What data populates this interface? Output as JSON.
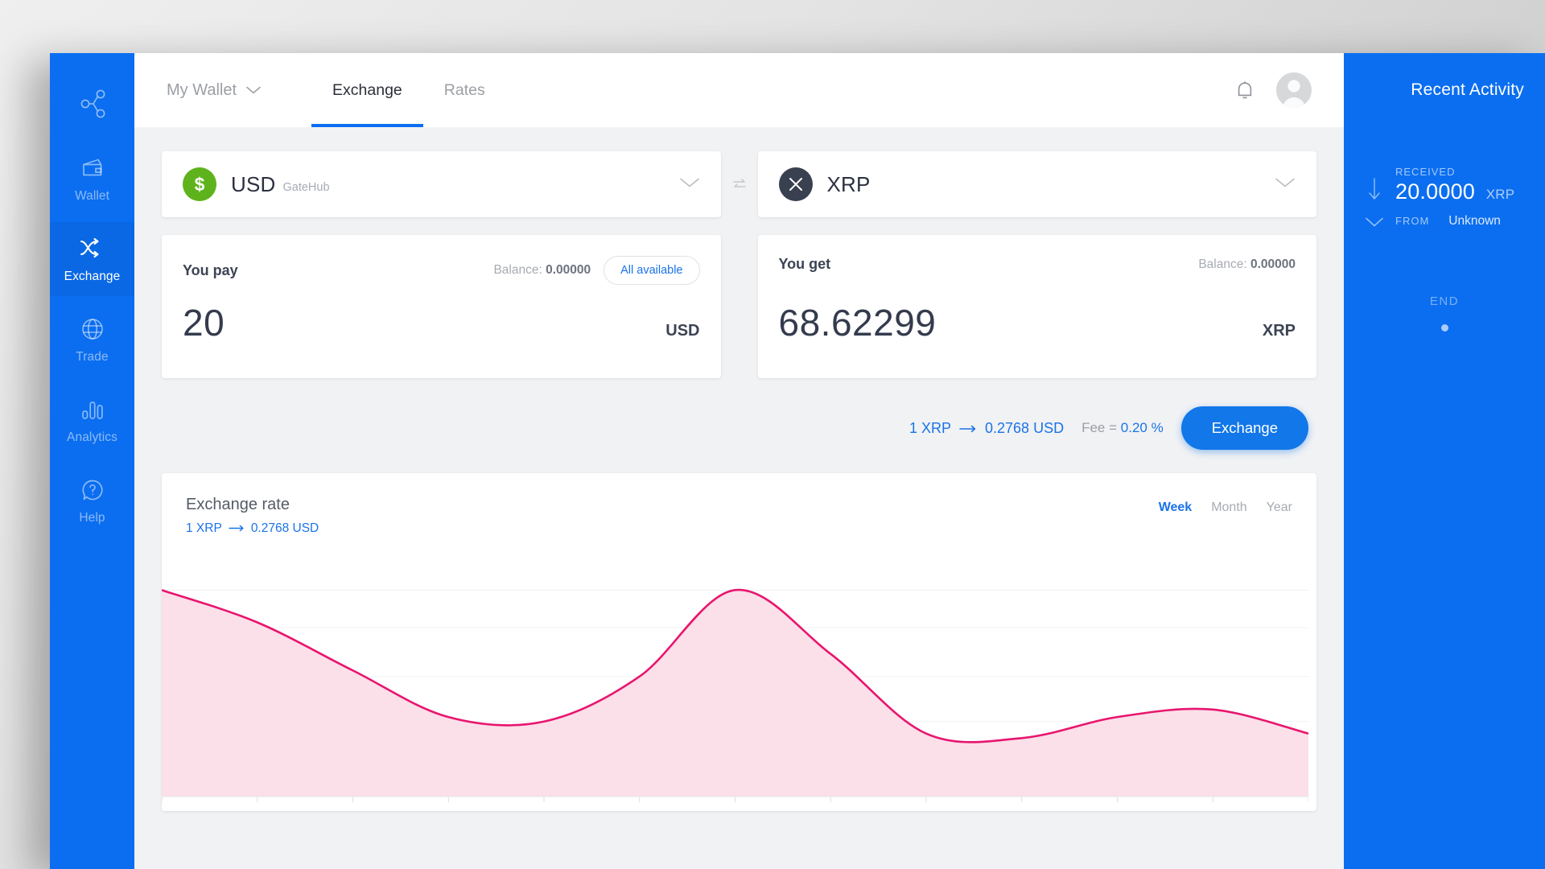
{
  "sidebar": {
    "logo_icon": "share-nodes-icon",
    "items": [
      {
        "label": "Wallet",
        "icon": "wallet-icon",
        "active": false
      },
      {
        "label": "Exchange",
        "icon": "shuffle-icon",
        "active": true
      },
      {
        "label": "Trade",
        "icon": "globe-icon",
        "active": false
      },
      {
        "label": "Analytics",
        "icon": "bar-chart-icon",
        "active": false
      },
      {
        "label": "Help",
        "icon": "question-help-icon",
        "active": false
      }
    ]
  },
  "topbar": {
    "wallet_selector": "My Wallet",
    "wallet_chevron_icon": "chevron-down-icon",
    "tabs": [
      {
        "label": "Exchange",
        "active": true
      },
      {
        "label": "Rates",
        "active": false
      }
    ],
    "notifications_icon": "bell-icon",
    "avatar_icon": "user-avatar-icon"
  },
  "exchange": {
    "from": {
      "code": "USD",
      "issuer": "GateHub",
      "badge_symbol": "$",
      "badge_color": "#5eb31c",
      "chevron_icon": "chevron-down-icon"
    },
    "swap_icon": "swap-horizontal-icon",
    "to": {
      "code": "XRP",
      "issuer": "",
      "badge_symbol": "✕",
      "badge_color": "#39404f",
      "chevron_icon": "chevron-down-icon"
    },
    "pay": {
      "title": "You pay",
      "balance_label": "Balance:",
      "balance_value": "0.00000",
      "all_available_label": "All available",
      "amount": "20",
      "currency": "USD",
      "placeholder": "0"
    },
    "get": {
      "title": "You get",
      "balance_label": "Balance:",
      "balance_value": "0.00000",
      "amount": "68.62299",
      "currency": "XRP",
      "placeholder": "0"
    },
    "rate_from": "1 XRP",
    "rate_arrow_icon": "arrow-right-icon",
    "rate_to": "0.2768 USD",
    "fee_label": "Fee =",
    "fee_value": "0.20 %",
    "exchange_button": "Exchange"
  },
  "chart_panel": {
    "title": "Exchange rate",
    "rate_from": "1 XRP",
    "rate_arrow_icon": "arrow-right-icon",
    "rate_to": "0.2768 USD",
    "ranges": [
      {
        "label": "Week",
        "active": true
      },
      {
        "label": "Month",
        "active": false
      },
      {
        "label": "Year",
        "active": false
      }
    ]
  },
  "chart_data": {
    "type": "area",
    "title": "Exchange rate",
    "xlabel": "",
    "ylabel": "",
    "grid": true,
    "legend": null,
    "line_color": "#e8156e",
    "fill_color": "#fbdfe9",
    "ylim": [
      0.26,
      0.29
    ],
    "gridlines": [
      0.2875,
      0.2825,
      0.276,
      0.27
    ],
    "x": [
      0,
      1,
      2,
      3,
      4,
      5,
      6,
      7,
      8,
      9,
      10,
      11,
      12
    ],
    "values": [
      0.2875,
      0.2832,
      0.2768,
      0.2706,
      0.27,
      0.276,
      0.2875,
      0.279,
      0.2684,
      0.2678,
      0.2706,
      0.2716,
      0.2684
    ],
    "tick_count": 13
  },
  "activity": {
    "title": "Recent Activity",
    "items": [
      {
        "kind": "RECEIVED",
        "amount": "20.0000",
        "currency": "XRP",
        "from_label": "FROM",
        "from_value": "Unknown",
        "down_arrow_icon": "arrow-down-icon",
        "chevron_icon": "chevron-down-icon"
      }
    ],
    "end_label": "END"
  }
}
